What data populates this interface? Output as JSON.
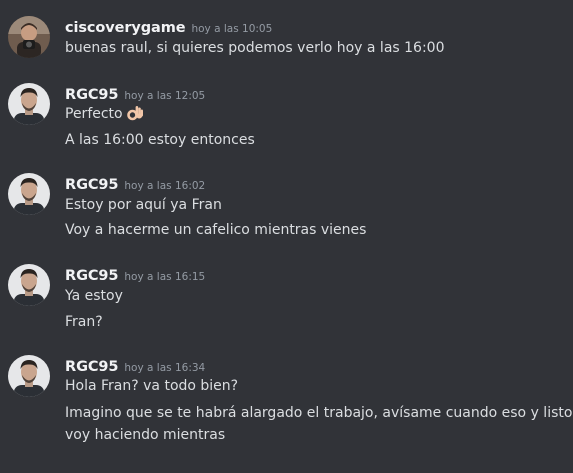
{
  "messages": [
    {
      "username": "ciscoverygame",
      "timestamp": "hoy a las 10:05",
      "lines": [
        "buenas raul, si quieres podemos verlo hoy a las 16:00"
      ]
    },
    {
      "username": "RGC95",
      "timestamp": "hoy a las 12:05",
      "lines": [
        "Perfecto",
        "A las 16:00 estoy entonces"
      ]
    },
    {
      "username": "RGC95",
      "timestamp": "hoy a las 16:02",
      "lines": [
        "Estoy por aquí ya Fran",
        "Voy a hacerme un cafelico mientras vienes"
      ]
    },
    {
      "username": "RGC95",
      "timestamp": "hoy a las 16:15",
      "lines": [
        "Ya estoy",
        "Fran?"
      ]
    },
    {
      "username": "RGC95",
      "timestamp": "hoy a las 16:34",
      "lines": [
        "Hola Fran? va todo bien?",
        "Imagino que se te habrá alargado el trabajo, avísame cuando eso y listo,",
        "voy haciendo mientras"
      ]
    }
  ],
  "icons": {
    "ok_hand": "ok-hand-emoji",
    "avatar_cisco": "ciscoverygame-avatar",
    "avatar_rgc": "rgc95-avatar"
  }
}
